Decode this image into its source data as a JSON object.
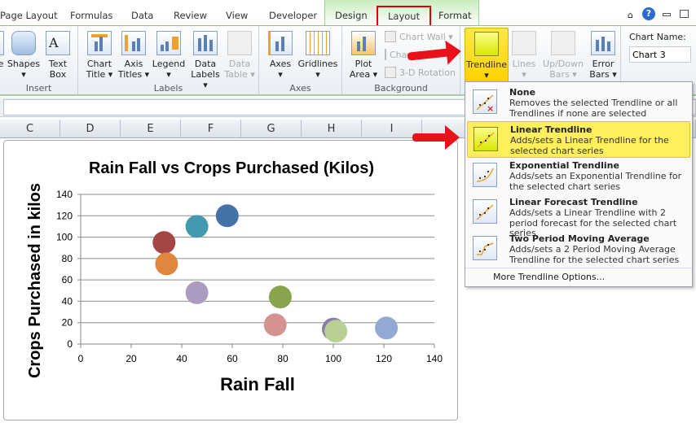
{
  "tabs": [
    "Page Layout",
    "Formulas",
    "Data",
    "Review",
    "View",
    "Developer",
    "Design",
    "Layout",
    "Format"
  ],
  "active_tab": "Layout",
  "ribbon": {
    "insert": {
      "label": "Insert",
      "buttons": [
        "Shapes",
        "Text Box"
      ],
      "cut_label": "e"
    },
    "labels": {
      "label": "Labels",
      "buttons": [
        {
          "l1": "Chart",
          "l2": "Title ▾"
        },
        {
          "l1": "Axis",
          "l2": "Titles ▾"
        },
        {
          "l1": "Legend",
          "l2": "▾"
        },
        {
          "l1": "Data",
          "l2": "Labels ▾"
        },
        {
          "l1": "Data",
          "l2": "Table ▾"
        }
      ]
    },
    "axes": {
      "label": "Axes",
      "buttons": [
        {
          "l1": "Axes",
          "l2": "▾"
        },
        {
          "l1": "Gridlines",
          "l2": "▾"
        }
      ]
    },
    "background": {
      "label": "Background",
      "plot_area": {
        "l1": "Plot",
        "l2": "Area ▾"
      },
      "chart_wall": "Chart Wall ▾",
      "chart_floor": "Chart Floor ▾",
      "rotation": "3-D Rotation"
    },
    "analysis": {
      "buttons": [
        {
          "l1": "Trendline",
          "l2": "▾"
        },
        {
          "l1": "Lines",
          "l2": "▾"
        },
        {
          "l1": "Up/Down",
          "l2": "Bars ▾"
        },
        {
          "l1": "Error",
          "l2": "Bars ▾"
        }
      ]
    },
    "properties": {
      "label": "Chart Name:",
      "value": "Chart 3"
    }
  },
  "columns": [
    "C",
    "D",
    "E",
    "F",
    "G",
    "H",
    "I"
  ],
  "trendline_menu": {
    "items": [
      {
        "title": "None",
        "desc": "Removes the selected Trendline or all Trendlines if none are selected"
      },
      {
        "title": "Linear Trendline",
        "desc": "Adds/sets a Linear Trendline for the selected chart series"
      },
      {
        "title": "Exponential Trendline",
        "desc": "Adds/sets an Exponential Trendline for the selected chart series"
      },
      {
        "title": "Linear Forecast Trendline",
        "desc": "Adds/sets a Linear Trendline with 2 period forecast for the selected chart series"
      },
      {
        "title": "Two Period Moving Average",
        "desc": "Adds/sets a 2 Period Moving Average Trendline for the selected chart series"
      }
    ],
    "highlighted": "Linear Trendline",
    "more": "More Trendline Options..."
  },
  "chart_data": {
    "type": "scatter",
    "title": "Rain Fall vs Crops Purchased (Kilos)",
    "xlabel": "Rain Fall",
    "ylabel": "Crops Purchased in kilos",
    "xlim": [
      0,
      140
    ],
    "ylim": [
      0,
      140
    ],
    "xticks": [
      "0",
      "20",
      "40",
      "60",
      "80",
      "100",
      "120",
      "140"
    ],
    "yticks": [
      "0",
      "20",
      "40",
      "60",
      "80",
      "100",
      "120",
      "140"
    ],
    "grid": "horizontal",
    "points": [
      {
        "x": 33,
        "y": 95,
        "color": "#a44644"
      },
      {
        "x": 34,
        "y": 75,
        "color": "#e0873f"
      },
      {
        "x": 46,
        "y": 110,
        "color": "#4299b0"
      },
      {
        "x": 58,
        "y": 120,
        "color": "#4471a6"
      },
      {
        "x": 46,
        "y": 48,
        "color": "#a99cc0"
      },
      {
        "x": 79,
        "y": 44,
        "color": "#88a44d"
      },
      {
        "x": 77,
        "y": 18,
        "color": "#d49290"
      },
      {
        "x": 100,
        "y": 14,
        "color": "#8a7ca8"
      },
      {
        "x": 101,
        "y": 12,
        "color": "#b9cf94"
      },
      {
        "x": 121,
        "y": 15,
        "color": "#91a9d3"
      }
    ]
  }
}
